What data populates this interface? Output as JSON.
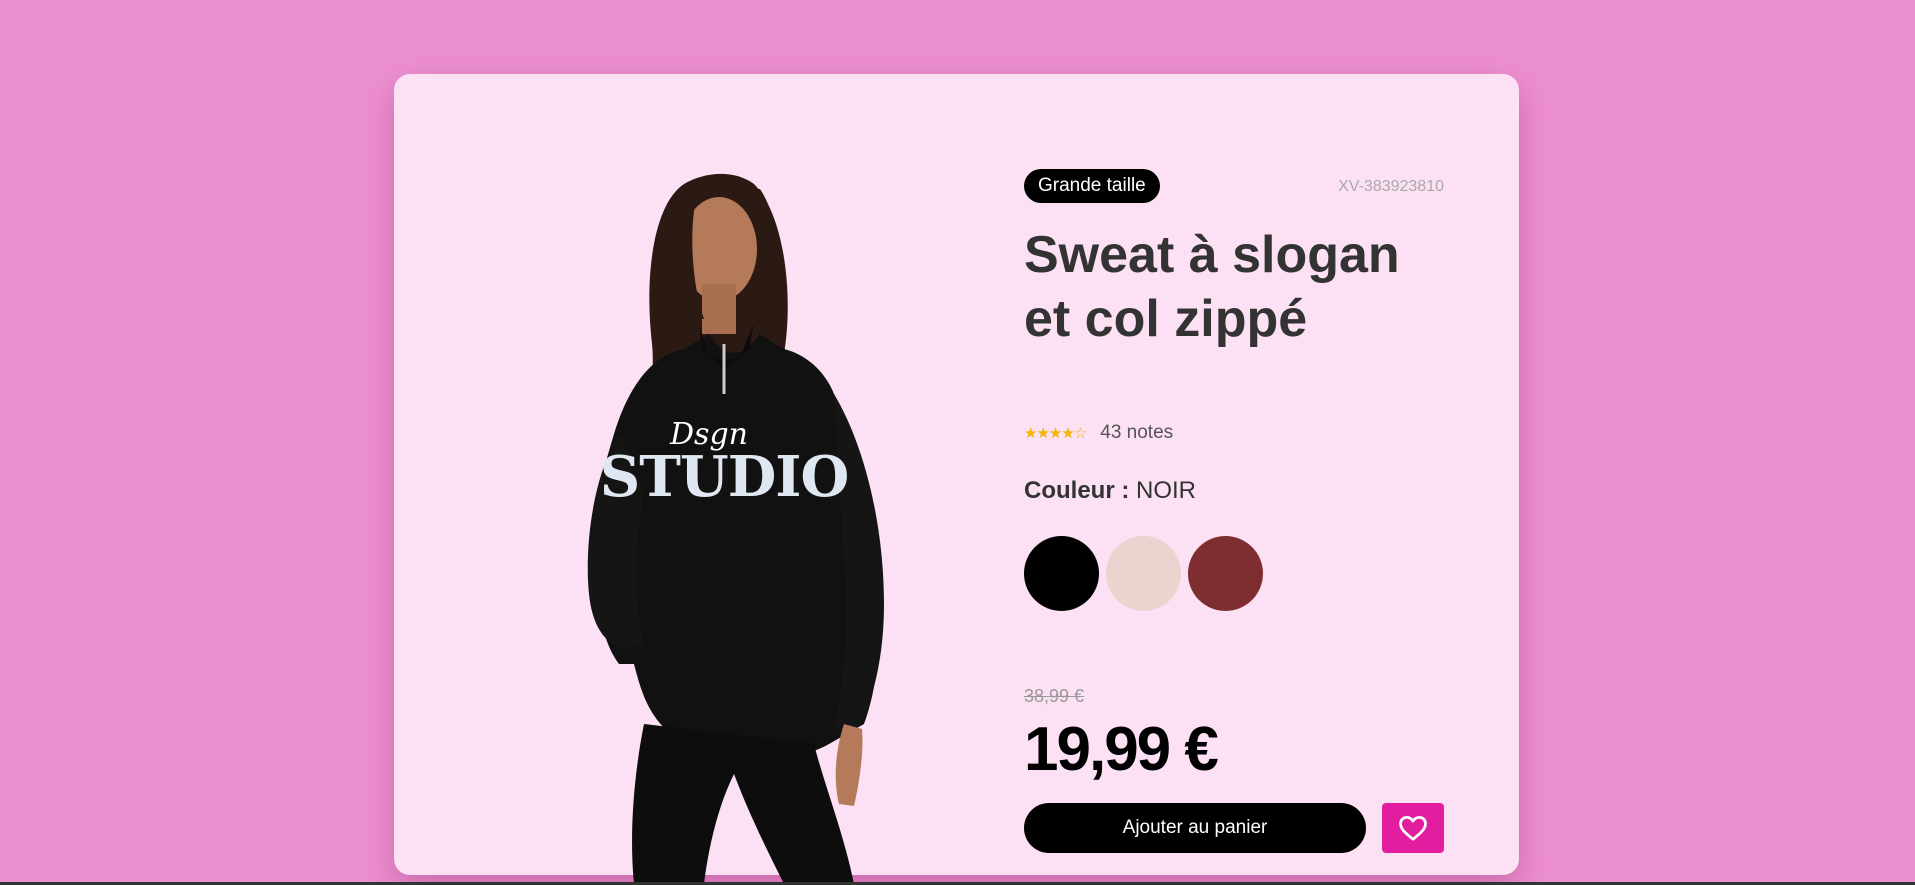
{
  "product": {
    "badge": "Grande taille",
    "sku": "XV-383923810",
    "title": "Sweat à slogan et col zippé",
    "image_alt_text": "Dsgn STUDIO",
    "image_text_script": "Dsgn",
    "image_text_main": "STUDIO",
    "rating": {
      "stars": "★★★★☆",
      "count_label": "43 notes"
    },
    "color": {
      "label": "Couleur :",
      "selected": "NOIR",
      "swatches": [
        {
          "name": "black",
          "hex": "#000000"
        },
        {
          "name": "blush",
          "hex": "#ecd3d0"
        },
        {
          "name": "burgundy",
          "hex": "#7e2d30"
        }
      ]
    },
    "old_price": "38,99 €",
    "price": "19,99 €",
    "add_to_cart_label": "Ajouter au panier",
    "wishlist_icon": "heart-icon"
  },
  "colors": {
    "page_background": "#ec8fcf",
    "card_background": "#fce0f3",
    "accent": "#e21da0",
    "star": "#f5b400"
  }
}
